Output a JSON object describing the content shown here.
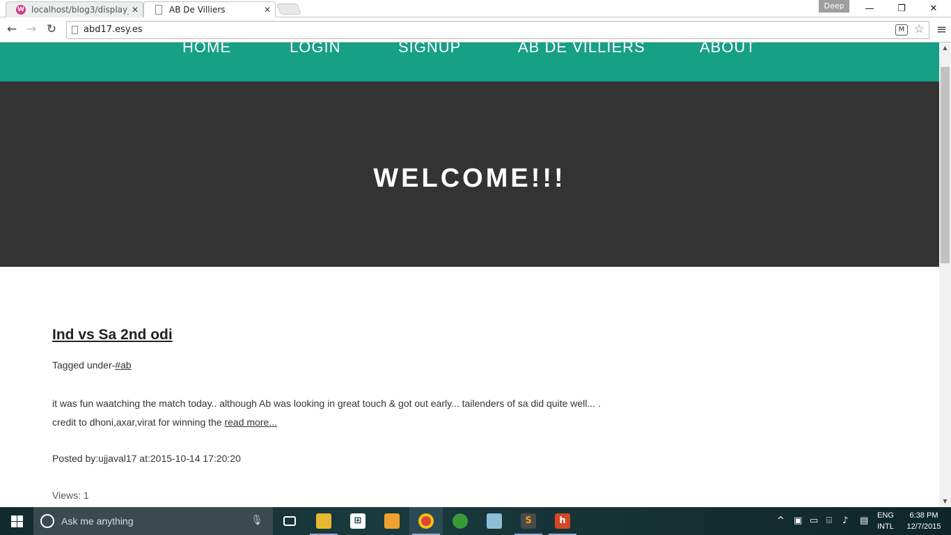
{
  "browser": {
    "tabs": [
      {
        "title": "localhost/blog3/display_p",
        "favicon": "w-icon",
        "active": false
      },
      {
        "title": "AB De Villiers",
        "favicon": "page-icon",
        "active": true
      }
    ],
    "profile": "Deep",
    "url": "abd17.esy.es",
    "window_controls": {
      "minimize": "—",
      "restore": "❐",
      "close": "✕"
    }
  },
  "site": {
    "nav": [
      "HOME",
      "LOGIN",
      "SIGNUP",
      "AB DE VILLIERS",
      "ABOUT"
    ],
    "hero_title": "WELCOME!!!",
    "accent_color": "#16a085",
    "hero_color": "#333333"
  },
  "post": {
    "title": "Ind vs Sa 2nd odi",
    "tags_prefix": "Tagged under-",
    "tag": "#ab",
    "body": "it was fun waatching the match today.. although Ab was looking in great touch & got out early... tailenders of sa did quite well... . credit to dhoni,axar,virat for winning the ",
    "read_more": "read more...",
    "meta": "Posted by:ujjaval17 at:2015-10-14 17:20:20",
    "more_label": "Views: 1"
  },
  "taskbar": {
    "search_placeholder": "Ask me anything",
    "language": [
      "ENG",
      "INTL"
    ],
    "time": "6:38 PM",
    "date": "12/7/2015"
  }
}
